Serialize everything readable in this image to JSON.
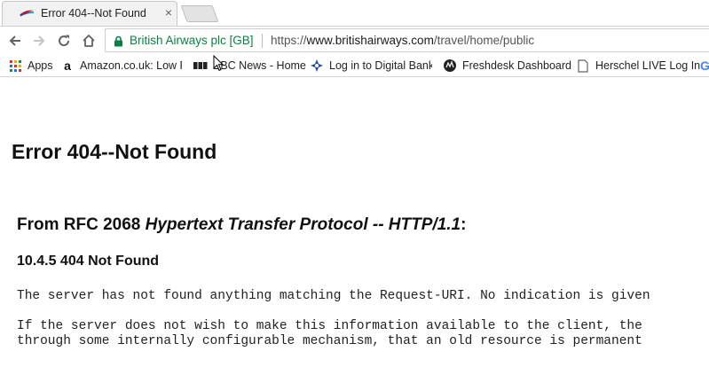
{
  "tab": {
    "title": "Error 404--Not Found",
    "favicon": "british-airways-speedmarque-icon",
    "close_label": "×"
  },
  "toolbar": {
    "ev_label": "British Airways plc [GB]",
    "url_scheme": "https://",
    "url_host": "www.britishairways.com",
    "url_path": "/travel/home/public"
  },
  "bookmarks": [
    {
      "label": "Apps",
      "icon": "apps-grid-icon"
    },
    {
      "label": "Amazon.co.uk: Low Pr",
      "icon": "amazon-icon"
    },
    {
      "label": "BBC News - Home",
      "icon": "bbc-icon"
    },
    {
      "label": "Log in to Digital Bank",
      "icon": "bank-icon"
    },
    {
      "label": "Freshdesk Dashboard",
      "icon": "freshdesk-icon"
    },
    {
      "label": "Herschel LIVE Log In",
      "icon": "page-icon"
    },
    {
      "label": "G",
      "icon": "google-icon"
    }
  ],
  "page": {
    "heading": "Error 404--Not Found",
    "rfc_prefix": "From RFC 2068 ",
    "rfc_title": "Hypertext Transfer Protocol -- HTTP/1.1",
    "rfc_suffix": ":",
    "section": "10.4.5 404 Not Found",
    "paragraph1": "The server has not found anything matching the Request-URI. No indication is given",
    "paragraph2_line1": "If the server does not wish to make this information available to the client, the",
    "paragraph2_line2": "through some internally configurable mechanism, that an old resource is permanent"
  },
  "colors": {
    "secure_green": "#0b8043",
    "ba_red": "#c8102e",
    "ba_blue": "#075aaa"
  }
}
